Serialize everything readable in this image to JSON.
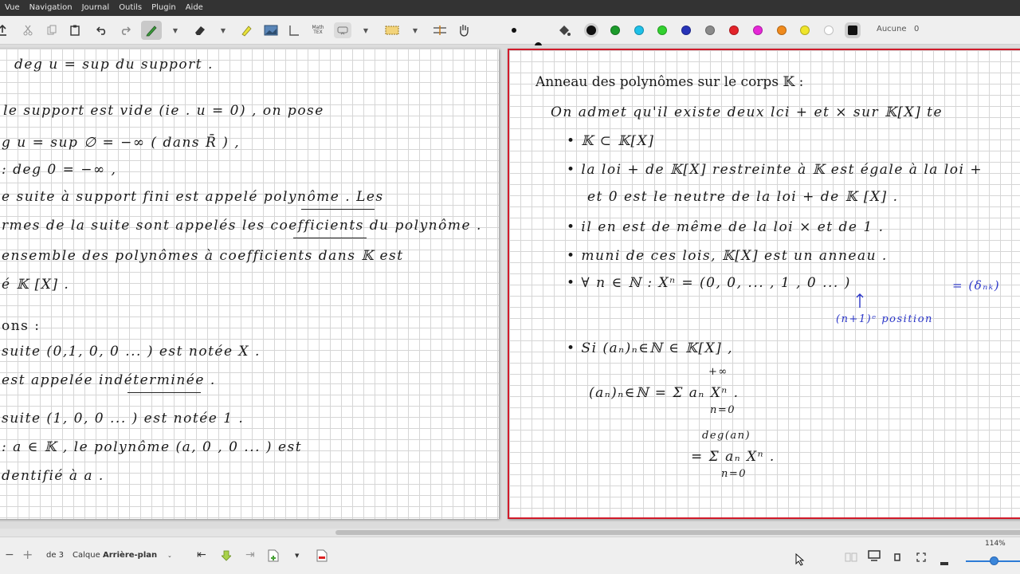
{
  "menu": [
    "Vue",
    "Navigation",
    "Journal",
    "Outils",
    "Plugin",
    "Aide"
  ],
  "toolbar": {
    "math_tex_label": "Math\nTEX",
    "fill_label": "Aucune",
    "fill_value": "0",
    "colors": [
      "#111111",
      "#1c9b2b",
      "#1ec0e8",
      "#32d12f",
      "#2733b8",
      "#8a8a8a",
      "#e3232a",
      "#e627d7",
      "#f08a1c",
      "#efe52a",
      "#ffffff",
      "#111111"
    ]
  },
  "left_page": {
    "lines": [
      "deg u =  sup  du  support .",
      "le support est vide   (ie . u = 0) , on pose",
      "g u =  sup ∅   = −∞   ( dans R̄ ) ,",
      ":   deg  0   = −∞   ,",
      "e suite à support fini est appelé polynôme . Les",
      "rmes de la suite sont appelés les coefficients du polynôme .",
      "ensemble des polynômes à coefficients dans  𝕂  est",
      "é   𝕂 [X] .",
      "ons :",
      "suite  (0,1, 0, 0 ... )  est notée   X .",
      "est appelée  indéterminée .",
      "suite  (1, 0, 0 ... )  est notée   1 .",
      ":  a ∈ 𝕂 ,  le polynôme   (a, 0 , 0 ... )  est",
      "dentifié  à   a ."
    ]
  },
  "right_page": {
    "title": "Anneau des polynômes sur le corps 𝕂 :",
    "lines": [
      "On admet qu'il existe  deux lci   + et × sur 𝕂[X] te",
      "•  𝕂  ⊂ 𝕂[X]",
      "•  la loi  +  de 𝕂[X]  restreinte à 𝕂  est égale à la loi +",
      "et  0  est le neutre de la loi  +  de  𝕂 [X] .",
      "•  il en est de même de la loi × et de 1 .",
      "•  muni de ces lois,  𝕂[X] est un anneau .",
      "•  ∀ n ∈ ℕ :   Xⁿ  = (0, 0, ... , 1 , 0 ... )",
      "•  Si  (aₙ)ₙ∈ℕ  ∈ 𝕂[X] ,",
      "(aₙ)ₙ∈ℕ   =   Σ  aₙ Xⁿ  .",
      "=   Σ   aₙ Xⁿ ."
    ],
    "blue_notes": [
      "= (δₙₖ)",
      "(n+1)ᵉ position"
    ],
    "sum_top": "+∞",
    "sum_bottom": "n=0",
    "sum2_top": "deg(an)",
    "sum2_bottom": "n=0"
  },
  "status": {
    "page_of": "de 3",
    "layer_label": "Calque",
    "layer_value": "Arrière-plan",
    "zoom": "114%"
  }
}
